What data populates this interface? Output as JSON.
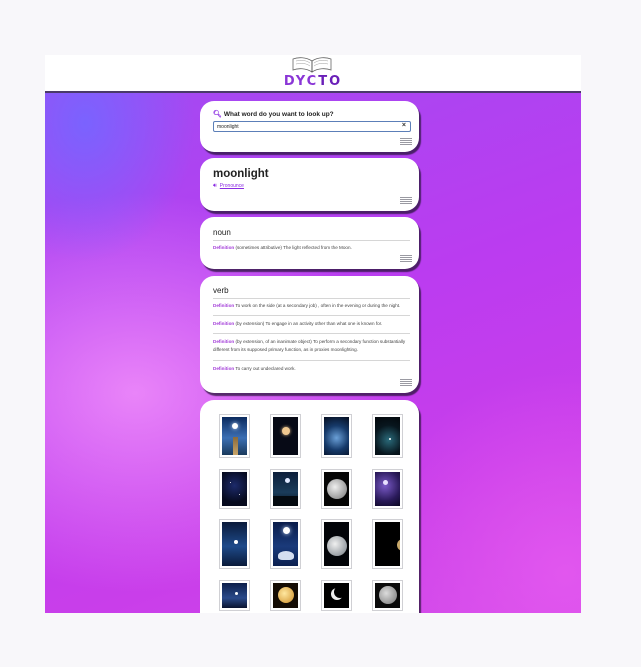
{
  "app": {
    "logo_prefix": "DYC",
    "logo_suffix": "TO"
  },
  "search": {
    "label": "What word do you want to look up?",
    "value": "moonlight",
    "clear": "×"
  },
  "entry": {
    "word": "moonlight",
    "pronounce_label": "Pronounce"
  },
  "noun": {
    "pos": "noun",
    "definitions": [
      {
        "tag": "Definition",
        "text": " (sometimes attributive) The light reflected from the Moon."
      }
    ]
  },
  "verb": {
    "pos": "verb",
    "definitions": [
      {
        "tag": "Definition",
        "text": " To work on the side (at a secondary job) , often in the evening or during the night."
      },
      {
        "tag": "Definition",
        "text": " (by extension) To engage in an activity other than what one is known for."
      },
      {
        "tag": "Definition",
        "text": " (by extension, of an inanimate object) To perform a secondary function substantially different from its supposed primary function, as in proxies moonlighting."
      },
      {
        "tag": "Definition",
        "text": " To carry out undeclared work."
      }
    ]
  },
  "gallery": {
    "images": [
      {
        "name": "moonlit-pier"
      },
      {
        "name": "moon-over-horizon"
      },
      {
        "name": "moon-through-clouds"
      },
      {
        "name": "moonlit-night-sky"
      },
      {
        "name": "starry-night"
      },
      {
        "name": "moon-over-trees"
      },
      {
        "name": "full-moon-close-up"
      },
      {
        "name": "purple-starry-sky"
      },
      {
        "name": "moon-over-water"
      },
      {
        "name": "moonlit-lotus"
      },
      {
        "name": "full-moon-blue"
      },
      {
        "name": "moon-edge-dark"
      },
      {
        "name": "moon-over-sea"
      },
      {
        "name": "golden-moon"
      },
      {
        "name": "crescent-moon"
      },
      {
        "name": "grey-full-moon"
      }
    ]
  },
  "colors": {
    "accent": "#8a2be2",
    "header_border": "#4a3a6a",
    "bg_start": "#a24af2",
    "bg_end": "#d24ae8"
  }
}
